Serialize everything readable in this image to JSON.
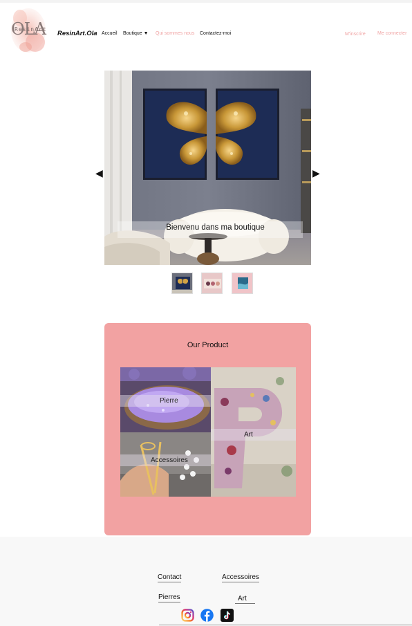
{
  "header": {
    "logo_text": "OLA",
    "logo_subtext": "ResinArt",
    "brand": "ResinArt.Ola",
    "nav": [
      {
        "label": "Accueil"
      },
      {
        "label": "Boutique"
      },
      {
        "label": "Qui sommes nous"
      },
      {
        "label": "Contactez-moi"
      }
    ],
    "signup": "M'inscrire",
    "login": "Me connecter"
  },
  "slider": {
    "caption": "Bienvenu dans ma boutique",
    "prev_arrow": "◀",
    "next_arrow": "▶"
  },
  "products": {
    "title": "Our Product",
    "tiles": [
      {
        "label": "Pierre"
      },
      {
        "label": "Art"
      },
      {
        "label": "Accessoires"
      }
    ]
  },
  "footer": {
    "links": [
      {
        "label": "Contact"
      },
      {
        "label": "Accessoires"
      },
      {
        "label": "Pierres"
      },
      {
        "label": "Art"
      }
    ],
    "social": [
      "instagram-icon",
      "facebook-icon",
      "tiktok-icon"
    ]
  },
  "colors": {
    "accent_pink": "#f2a2a2",
    "nav_pink": "#f0a4a4",
    "facebook_blue": "#1877f2"
  }
}
